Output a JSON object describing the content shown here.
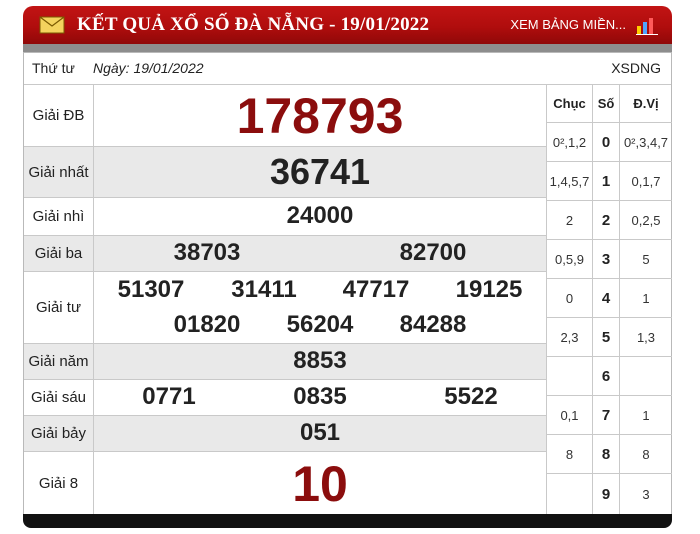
{
  "header": {
    "title": "KẾT QUẢ XỔ SỐ ĐÀ NẴNG - 19/01/2022",
    "link_label": "XEM BẢNG MIỀN...",
    "mail_icon": "mail-icon",
    "chart_icon": "bar-chart-icon",
    "color": "#b00d0d"
  },
  "info": {
    "day": "Thứ tư",
    "date": "Ngày: 19/01/2022",
    "code": "XSDNG"
  },
  "prizes": {
    "db": {
      "label": "Giải ĐB",
      "values": [
        "178793"
      ]
    },
    "nhat": {
      "label": "Giải nhất",
      "values": [
        "36741"
      ]
    },
    "nhi": {
      "label": "Giải nhì",
      "values": [
        "24000"
      ]
    },
    "ba": {
      "label": "Giải ba",
      "values": [
        "38703",
        "82700"
      ]
    },
    "tu": {
      "label": "Giải tư",
      "values": [
        "51307",
        "31411",
        "47717",
        "19125",
        "01820",
        "56204",
        "84288"
      ]
    },
    "nam": {
      "label": "Giải năm",
      "values": [
        "8853"
      ]
    },
    "sau": {
      "label": "Giải sáu",
      "values": [
        "0771",
        "0835",
        "5522"
      ]
    },
    "bay": {
      "label": "Giải bảy",
      "values": [
        "051"
      ]
    },
    "tam": {
      "label": "Giải 8",
      "values": [
        "10"
      ]
    }
  },
  "loto": {
    "headers": {
      "chuc": "Chục",
      "so": "Số",
      "dvi": "Đ.Vị"
    },
    "rows": [
      {
        "chuc": "0²,1,2",
        "so": "0",
        "dvi": "0²,3,4,7"
      },
      {
        "chuc": "1,4,5,7",
        "so": "1",
        "dvi": "0,1,7"
      },
      {
        "chuc": "2",
        "so": "2",
        "dvi": "0,2,5"
      },
      {
        "chuc": "0,5,9",
        "so": "3",
        "dvi": "5"
      },
      {
        "chuc": "0",
        "so": "4",
        "dvi": "1"
      },
      {
        "chuc": "2,3",
        "so": "5",
        "dvi": "1,3"
      },
      {
        "chuc": "",
        "so": "6",
        "dvi": ""
      },
      {
        "chuc": "0,1",
        "so": "7",
        "dvi": "1"
      },
      {
        "chuc": "8",
        "so": "8",
        "dvi": "8"
      },
      {
        "chuc": "",
        "so": "9",
        "dvi": "3"
      }
    ]
  }
}
